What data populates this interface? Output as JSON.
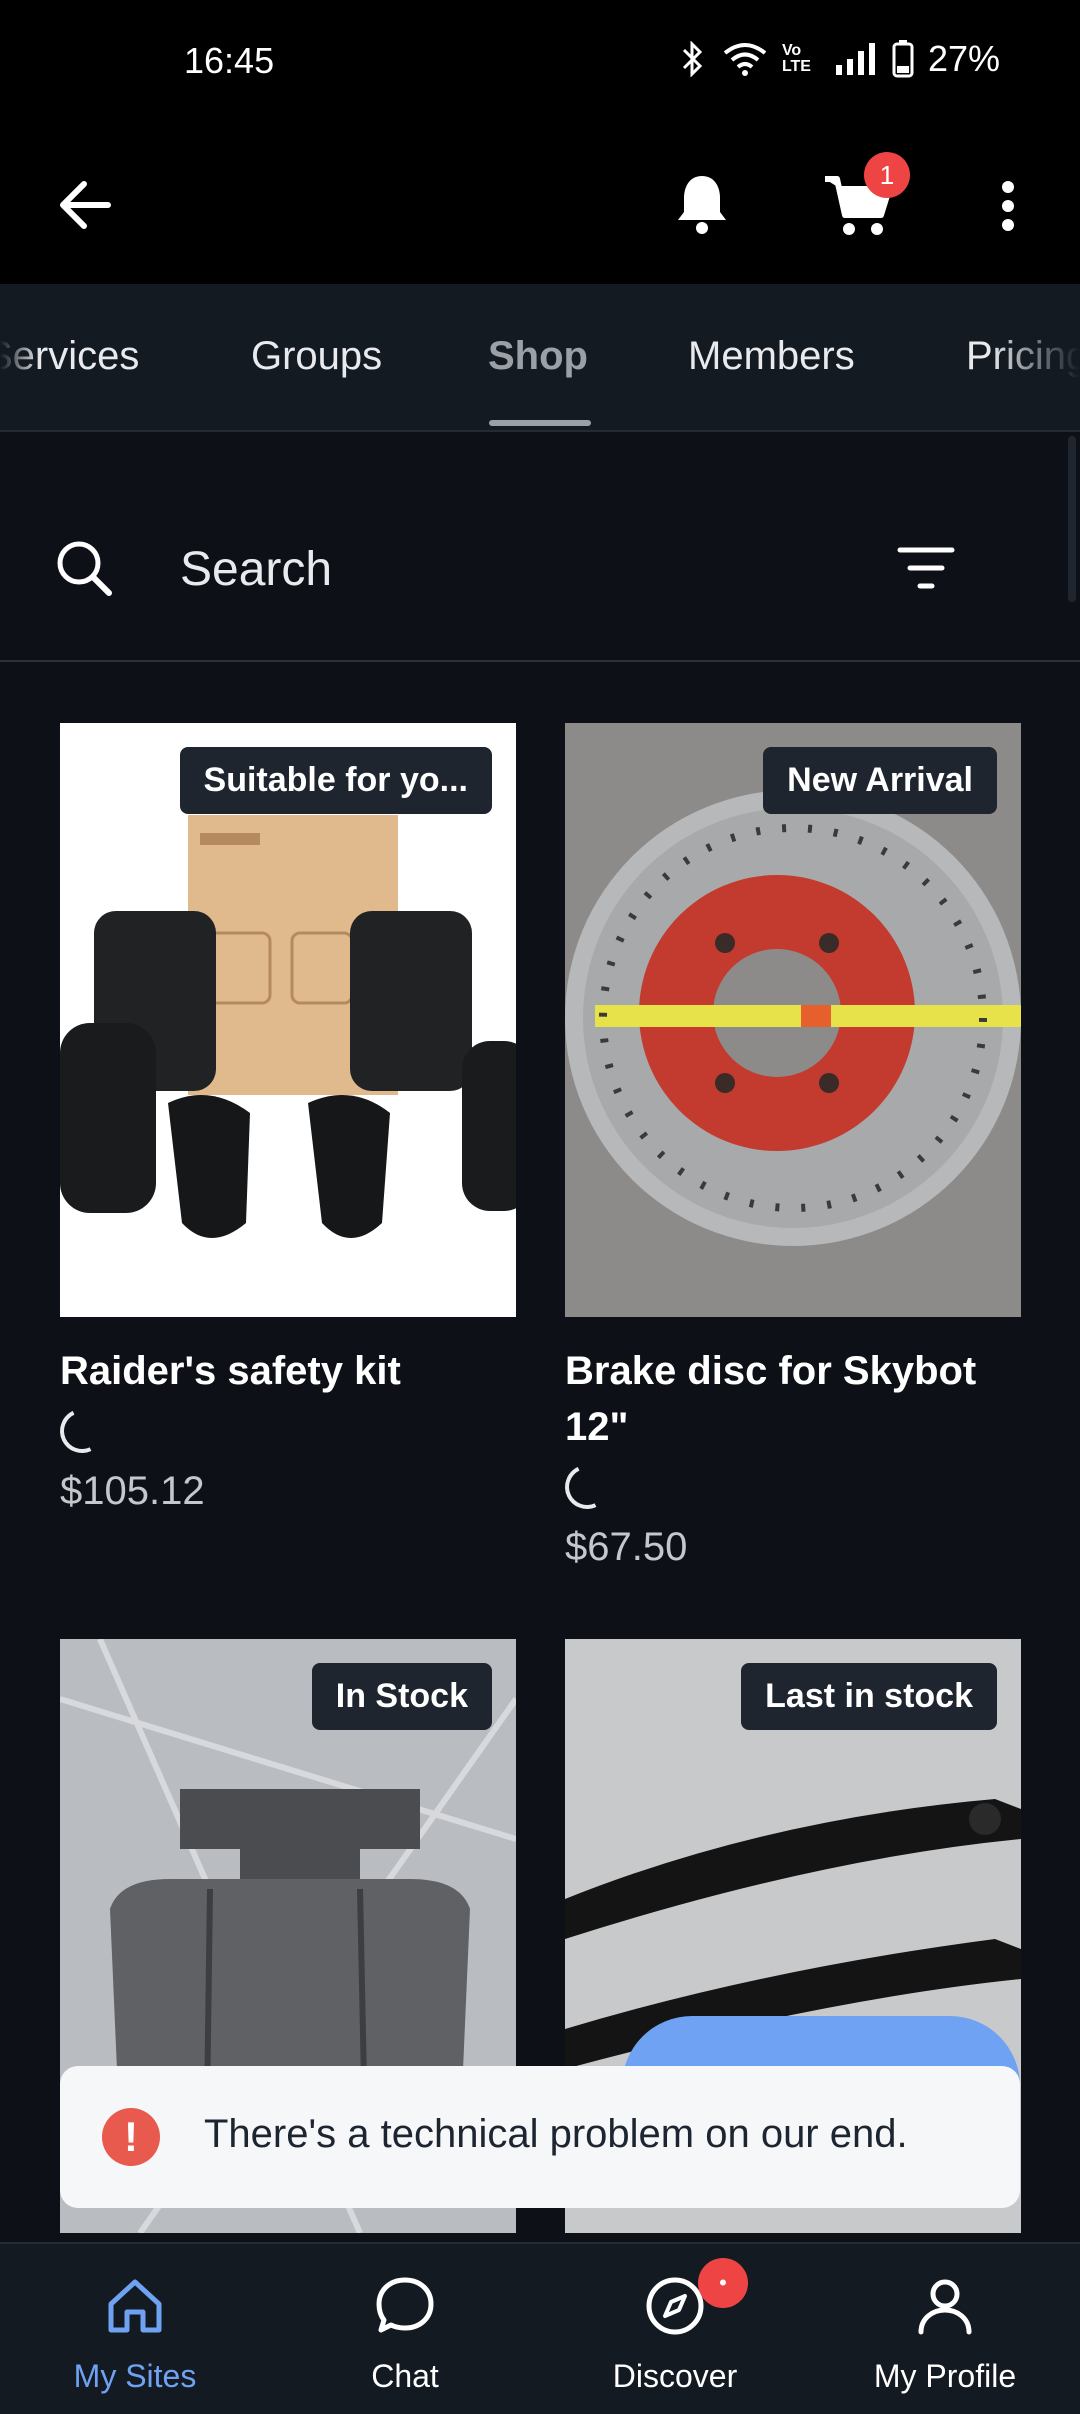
{
  "status_bar": {
    "time": "16:45",
    "battery": "27%",
    "network": "Vo LTE"
  },
  "app_bar": {
    "cart_count": "1"
  },
  "tabs": [
    {
      "label": "Services"
    },
    {
      "label": "Groups"
    },
    {
      "label": "Shop",
      "active": true
    },
    {
      "label": "Members"
    },
    {
      "label": "Pricing"
    }
  ],
  "search": {
    "placeholder": "Search"
  },
  "products": [
    {
      "name": "Raider's safety kit",
      "tag": "Suitable for yo...",
      "price": "$105.12",
      "image": "safety-kit-image"
    },
    {
      "name": "Brake disc for Skybot 12\"",
      "tag": "New Arrival",
      "price": "$67.50",
      "image": "brake-disc-image"
    },
    {
      "name": "",
      "tag": "In Stock",
      "price": "",
      "image": "brake-pad-image"
    },
    {
      "name": "",
      "tag": "Last in stock",
      "price": "",
      "image": "brake-lever-image"
    }
  ],
  "toast": {
    "message": "There's a technical problem on our end.",
    "icon": "error-icon"
  },
  "bottom_nav": [
    {
      "label": "My Sites",
      "icon": "home-icon",
      "active": true
    },
    {
      "label": "Chat",
      "icon": "chat-icon"
    },
    {
      "label": "Discover",
      "icon": "compass-icon",
      "badge": "•"
    },
    {
      "label": "My Profile",
      "icon": "profile-icon"
    }
  ],
  "colors": {
    "accent": "#6fa2f2",
    "badge": "#ef4444",
    "background": "#0d1117"
  }
}
